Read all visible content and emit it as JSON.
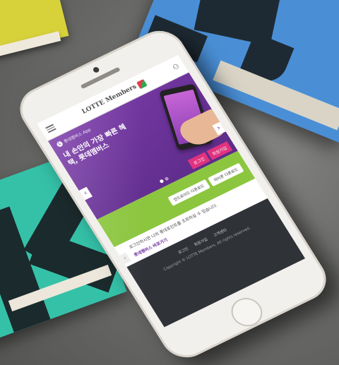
{
  "header": {
    "brand": "LOTTE Members"
  },
  "hero": {
    "app_label": "롯데멤버스 App",
    "title": "내 손안의 가장 빠른 혜택, 롯데멤버스",
    "buttons": [
      "로그인",
      "회원가입"
    ]
  },
  "green": {
    "store_buttons": [
      "안드로이드 다운로드",
      "아이폰 다운로드"
    ]
  },
  "notice": {
    "text": "로그인하시면 나의 롯데포인트를 조회하실 수 있습니다.",
    "highlight": "롯데멤버스 바로가기"
  },
  "footer": {
    "links": [
      "로그인",
      "회원가입",
      "고객센터"
    ],
    "copyright": "Copyright © LOTTE Members. All rights reserved."
  },
  "colors": {
    "purple": "#6b2f9a",
    "green": "#8cc63f",
    "pink": "#e0337f",
    "dark": "#2f3338"
  }
}
